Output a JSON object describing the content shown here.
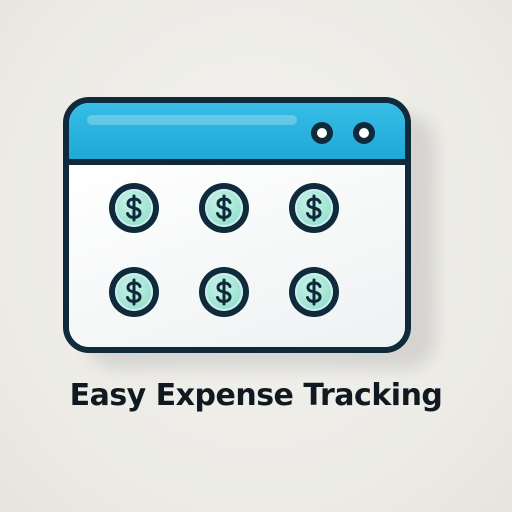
{
  "tagline": "Easy Expense Tracking",
  "icon": {
    "window_dots": [
      "window-dot",
      "window-dot"
    ],
    "coins": [
      {
        "symbol": "$"
      },
      {
        "symbol": "$"
      },
      {
        "symbol": "$"
      },
      {
        "symbol": "$"
      },
      {
        "symbol": "$"
      },
      {
        "symbol": "$"
      }
    ]
  },
  "colors": {
    "outline": "#0f2a3a",
    "title_bar": "#1fa9d6",
    "coin_fill": "#9fe3d3",
    "background": "#ecebe6",
    "text": "#101820"
  }
}
